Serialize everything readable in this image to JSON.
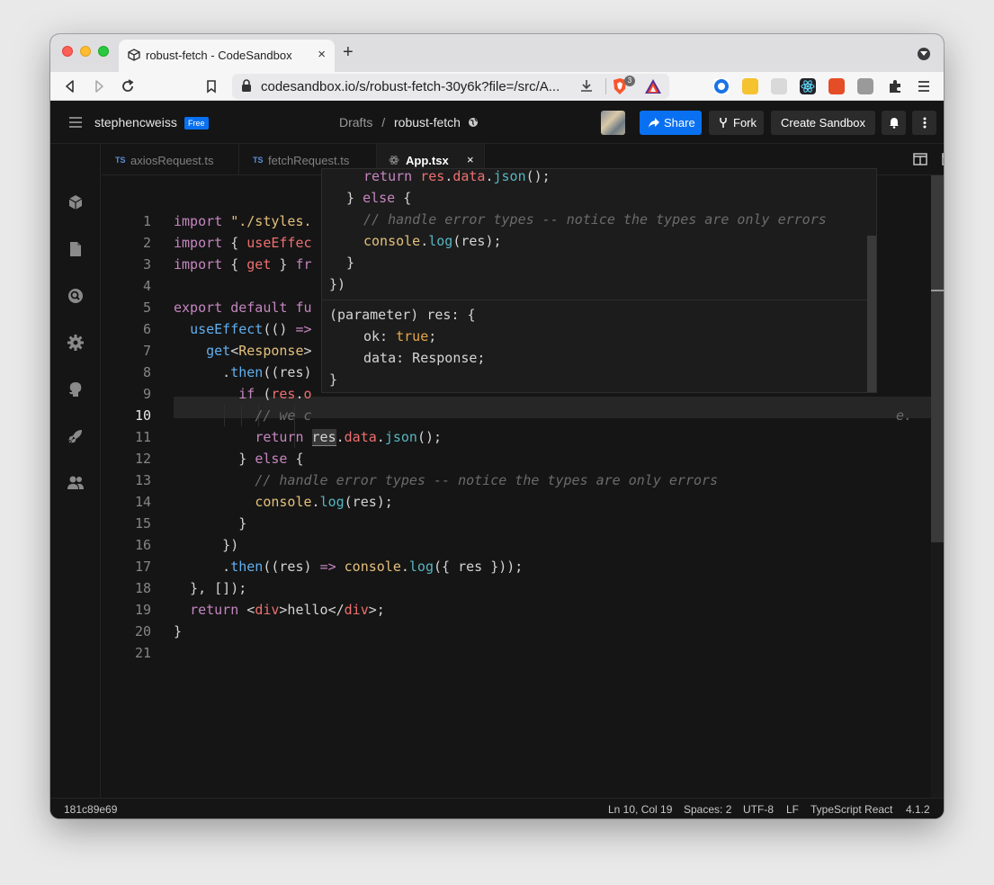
{
  "browser": {
    "tab_title": "robust-fetch - CodeSandbox",
    "tab_close": "×",
    "new_tab": "+",
    "url": "codesandbox.io/s/robust-fetch-30y6k?file=/src/A...",
    "brave_badge": "3"
  },
  "header": {
    "username": "stephencweiss",
    "plan_badge": "Free",
    "breadcrumb_folder": "Drafts",
    "breadcrumb_sep": "/",
    "sandbox_name": "robust-fetch",
    "share_label": "Share",
    "fork_label": "Fork",
    "create_label": "Create Sandbox"
  },
  "editor": {
    "tabs": [
      {
        "badge": "TS",
        "label": "axiosRequest.ts"
      },
      {
        "badge": "TS",
        "label": "fetchRequest.ts"
      },
      {
        "label": "App.tsx",
        "close": "×"
      }
    ]
  },
  "gutter": [
    "1",
    "2",
    "3",
    "4",
    "5",
    "6",
    "7",
    "8",
    "9",
    "10",
    "11",
    "12",
    "13",
    "14",
    "15",
    "16",
    "17",
    "18",
    "19",
    "20",
    "21"
  ],
  "status": {
    "commit": "181c89e69",
    "position": "Ln 10, Col 19",
    "spaces": "Spaces: 2",
    "encoding": "UTF-8",
    "eol": "LF",
    "language": "TypeScript React",
    "version": "4.1.2"
  },
  "colors": {
    "accent": "#0971f1",
    "background": "#151515"
  }
}
